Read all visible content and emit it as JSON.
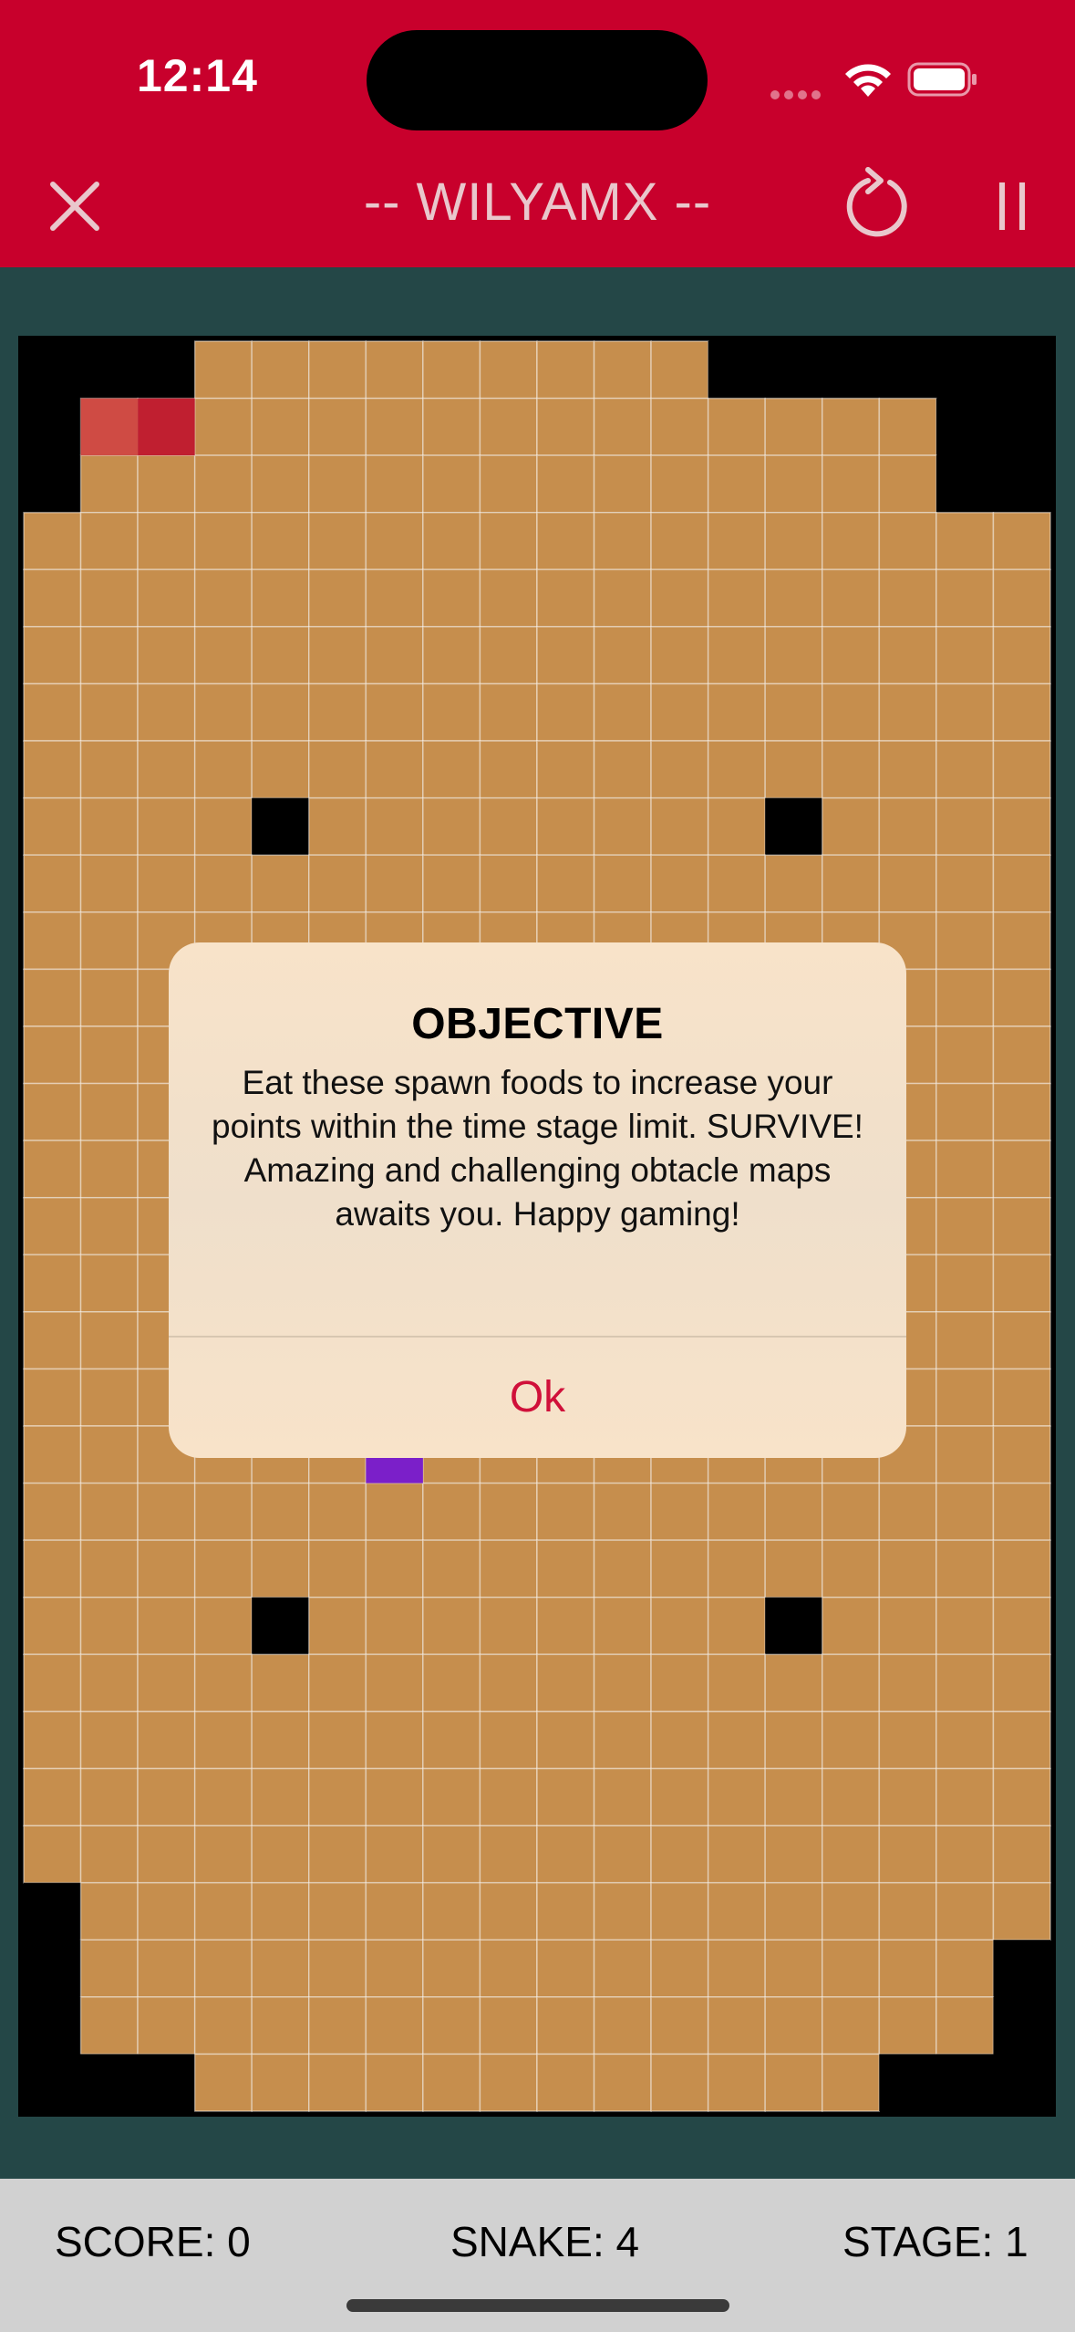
{
  "status_bar": {
    "time": "12:14"
  },
  "header": {
    "title": "-- WILYAMX --"
  },
  "dialog": {
    "title": "OBJECTIVE",
    "message": "Eat these spawn foods to increase your points within the time stage limit. SURVIVE! Amazing and challenging obtacle maps awaits you. Happy gaming!",
    "ok_label": "Ok"
  },
  "footer": {
    "score": "SCORE: 0",
    "snake": "SNAKE: 4",
    "stage": "STAGE: 1"
  },
  "colors": {
    "header_bg": "#c8002c",
    "background": "#244747",
    "board_tile": "#c68e4d",
    "obstacle": "#000000",
    "snake_head": "#cf4b44",
    "snake_body": "#c01f30",
    "food": "#7b1fc9",
    "dialog_bg": "#f8e3c9",
    "accent": "#d0103a"
  },
  "game": {
    "grid_columns": 18,
    "grid_rows": 31,
    "obstacles": [
      [
        0,
        0
      ],
      [
        1,
        0
      ],
      [
        2,
        0
      ],
      [
        0,
        1
      ],
      [
        0,
        2
      ],
      [
        12,
        0
      ],
      [
        13,
        0
      ],
      [
        14,
        0
      ],
      [
        15,
        0
      ],
      [
        16,
        0
      ],
      [
        17,
        0
      ],
      [
        16,
        1
      ],
      [
        17,
        1
      ],
      [
        16,
        2
      ],
      [
        17,
        2
      ],
      [
        4,
        8
      ],
      [
        13,
        8
      ],
      [
        4,
        22
      ],
      [
        13,
        22
      ],
      [
        0,
        27
      ],
      [
        0,
        28
      ],
      [
        0,
        29
      ],
      [
        0,
        30
      ],
      [
        1,
        30
      ],
      [
        2,
        30
      ],
      [
        17,
        28
      ],
      [
        17,
        29
      ],
      [
        17,
        30
      ],
      [
        16,
        30
      ],
      [
        15,
        30
      ]
    ],
    "snake": [
      [
        1,
        1
      ],
      [
        2,
        1
      ]
    ],
    "food": [
      [
        6,
        19
      ]
    ]
  }
}
